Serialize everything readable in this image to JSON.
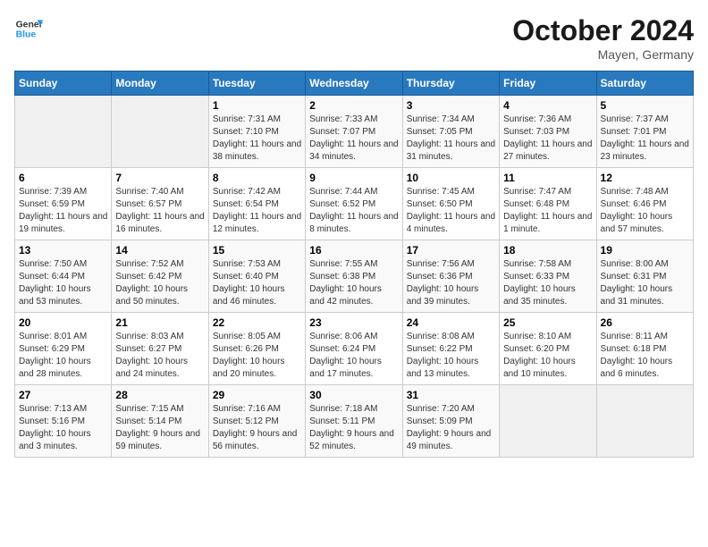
{
  "logo": {
    "general": "General",
    "blue": "Blue"
  },
  "title": "October 2024",
  "location": "Mayen, Germany",
  "days_of_week": [
    "Sunday",
    "Monday",
    "Tuesday",
    "Wednesday",
    "Thursday",
    "Friday",
    "Saturday"
  ],
  "weeks": [
    [
      {
        "day": "",
        "info": ""
      },
      {
        "day": "",
        "info": ""
      },
      {
        "day": "1",
        "info": "Sunrise: 7:31 AM\nSunset: 7:10 PM\nDaylight: 11 hours and 38 minutes."
      },
      {
        "day": "2",
        "info": "Sunrise: 7:33 AM\nSunset: 7:07 PM\nDaylight: 11 hours and 34 minutes."
      },
      {
        "day": "3",
        "info": "Sunrise: 7:34 AM\nSunset: 7:05 PM\nDaylight: 11 hours and 31 minutes."
      },
      {
        "day": "4",
        "info": "Sunrise: 7:36 AM\nSunset: 7:03 PM\nDaylight: 11 hours and 27 minutes."
      },
      {
        "day": "5",
        "info": "Sunrise: 7:37 AM\nSunset: 7:01 PM\nDaylight: 11 hours and 23 minutes."
      }
    ],
    [
      {
        "day": "6",
        "info": "Sunrise: 7:39 AM\nSunset: 6:59 PM\nDaylight: 11 hours and 19 minutes."
      },
      {
        "day": "7",
        "info": "Sunrise: 7:40 AM\nSunset: 6:57 PM\nDaylight: 11 hours and 16 minutes."
      },
      {
        "day": "8",
        "info": "Sunrise: 7:42 AM\nSunset: 6:54 PM\nDaylight: 11 hours and 12 minutes."
      },
      {
        "day": "9",
        "info": "Sunrise: 7:44 AM\nSunset: 6:52 PM\nDaylight: 11 hours and 8 minutes."
      },
      {
        "day": "10",
        "info": "Sunrise: 7:45 AM\nSunset: 6:50 PM\nDaylight: 11 hours and 4 minutes."
      },
      {
        "day": "11",
        "info": "Sunrise: 7:47 AM\nSunset: 6:48 PM\nDaylight: 11 hours and 1 minute."
      },
      {
        "day": "12",
        "info": "Sunrise: 7:48 AM\nSunset: 6:46 PM\nDaylight: 10 hours and 57 minutes."
      }
    ],
    [
      {
        "day": "13",
        "info": "Sunrise: 7:50 AM\nSunset: 6:44 PM\nDaylight: 10 hours and 53 minutes."
      },
      {
        "day": "14",
        "info": "Sunrise: 7:52 AM\nSunset: 6:42 PM\nDaylight: 10 hours and 50 minutes."
      },
      {
        "day": "15",
        "info": "Sunrise: 7:53 AM\nSunset: 6:40 PM\nDaylight: 10 hours and 46 minutes."
      },
      {
        "day": "16",
        "info": "Sunrise: 7:55 AM\nSunset: 6:38 PM\nDaylight: 10 hours and 42 minutes."
      },
      {
        "day": "17",
        "info": "Sunrise: 7:56 AM\nSunset: 6:36 PM\nDaylight: 10 hours and 39 minutes."
      },
      {
        "day": "18",
        "info": "Sunrise: 7:58 AM\nSunset: 6:33 PM\nDaylight: 10 hours and 35 minutes."
      },
      {
        "day": "19",
        "info": "Sunrise: 8:00 AM\nSunset: 6:31 PM\nDaylight: 10 hours and 31 minutes."
      }
    ],
    [
      {
        "day": "20",
        "info": "Sunrise: 8:01 AM\nSunset: 6:29 PM\nDaylight: 10 hours and 28 minutes."
      },
      {
        "day": "21",
        "info": "Sunrise: 8:03 AM\nSunset: 6:27 PM\nDaylight: 10 hours and 24 minutes."
      },
      {
        "day": "22",
        "info": "Sunrise: 8:05 AM\nSunset: 6:26 PM\nDaylight: 10 hours and 20 minutes."
      },
      {
        "day": "23",
        "info": "Sunrise: 8:06 AM\nSunset: 6:24 PM\nDaylight: 10 hours and 17 minutes."
      },
      {
        "day": "24",
        "info": "Sunrise: 8:08 AM\nSunset: 6:22 PM\nDaylight: 10 hours and 13 minutes."
      },
      {
        "day": "25",
        "info": "Sunrise: 8:10 AM\nSunset: 6:20 PM\nDaylight: 10 hours and 10 minutes."
      },
      {
        "day": "26",
        "info": "Sunrise: 8:11 AM\nSunset: 6:18 PM\nDaylight: 10 hours and 6 minutes."
      }
    ],
    [
      {
        "day": "27",
        "info": "Sunrise: 7:13 AM\nSunset: 5:16 PM\nDaylight: 10 hours and 3 minutes."
      },
      {
        "day": "28",
        "info": "Sunrise: 7:15 AM\nSunset: 5:14 PM\nDaylight: 9 hours and 59 minutes."
      },
      {
        "day": "29",
        "info": "Sunrise: 7:16 AM\nSunset: 5:12 PM\nDaylight: 9 hours and 56 minutes."
      },
      {
        "day": "30",
        "info": "Sunrise: 7:18 AM\nSunset: 5:11 PM\nDaylight: 9 hours and 52 minutes."
      },
      {
        "day": "31",
        "info": "Sunrise: 7:20 AM\nSunset: 5:09 PM\nDaylight: 9 hours and 49 minutes."
      },
      {
        "day": "",
        "info": ""
      },
      {
        "day": "",
        "info": ""
      }
    ]
  ]
}
